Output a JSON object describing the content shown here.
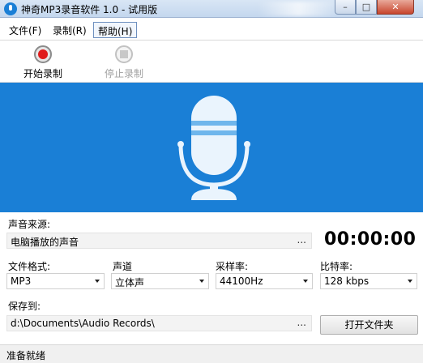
{
  "window": {
    "title": "神奇MP3录音软件 1.0 - 试用版",
    "minimize_glyph": "–",
    "maximize_glyph": "□",
    "close_glyph": "✕"
  },
  "menu": {
    "items": [
      "文件(F)",
      "录制(R)",
      "帮助(H)"
    ],
    "active_item": "帮助(H)"
  },
  "toolbar": {
    "start_label": "开始录制",
    "stop_label": "停止录制",
    "stop_enabled": false
  },
  "banner": {
    "icon": "microphone-icon",
    "color": "#1a7fd6"
  },
  "source": {
    "label": "声音来源:",
    "value": "电脑播放的声音",
    "browse": "..."
  },
  "timer": "00:00:00",
  "format": {
    "label": "文件格式:",
    "value": "MP3"
  },
  "channel": {
    "label": "声道",
    "value": "立体声"
  },
  "sample_rate": {
    "label": "采样率:",
    "value": "44100Hz"
  },
  "bitrate": {
    "label": "比特率:",
    "value": "128 kbps"
  },
  "save_to": {
    "label": "保存到:",
    "value": "d:\\Documents\\Audio Records\\",
    "browse": "..."
  },
  "open_folder_label": "打开文件夹",
  "status": "准备就绪",
  "colors": {
    "accent": "#1a7fd6",
    "record": "#e01c1c"
  }
}
